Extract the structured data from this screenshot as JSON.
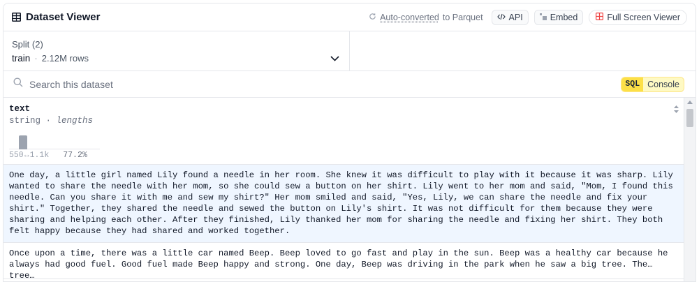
{
  "header": {
    "title": "Dataset Viewer",
    "auto_converted_link": "Auto-converted",
    "auto_converted_suffix": "to Parquet",
    "api_label": "API",
    "embed_label": "Embed",
    "fullscreen_label": "Full Screen Viewer"
  },
  "split": {
    "label": "Split (2)",
    "value": "train",
    "rows": "2.12M rows"
  },
  "search": {
    "placeholder": "Search this dataset"
  },
  "sql": {
    "tag": "SQL",
    "label": "Console"
  },
  "column": {
    "name": "text",
    "type": "string",
    "stat": "lengths",
    "hist_min": "550",
    "hist_max": "1.1k",
    "hist_pct": "77.2%",
    "hist_bar_fraction": 0.772
  },
  "rows": [
    "One day, a little girl named Lily found a needle in her room. She knew it was difficult to play with it because it was sharp. Lily wanted to share the needle with her mom, so she could sew a button on her shirt. Lily went to her mom and said, \"Mom, I found this needle. Can you share it with me and sew my shirt?\" Her mom smiled and said, \"Yes, Lily, we can share the needle and fix your shirt.\" Together, they shared the needle and sewed the button on Lily's shirt. It was not difficult for them because they were sharing and helping each other. After they finished, Lily thanked her mom for sharing the needle and fixing her shirt. They both felt happy because they had shared and worked together.",
    "Once upon a time, there was a little car named Beep. Beep loved to go fast and play in the sun. Beep was a healthy car because he always had good fuel. Good fuel made Beep happy and strong. One day, Beep was driving in the park when he saw a big tree. The tree…"
  ],
  "colors": {
    "selected_row": "#eff6ff",
    "sql_tag": "#fde047",
    "fullscreen_icon": "#ef4444"
  }
}
